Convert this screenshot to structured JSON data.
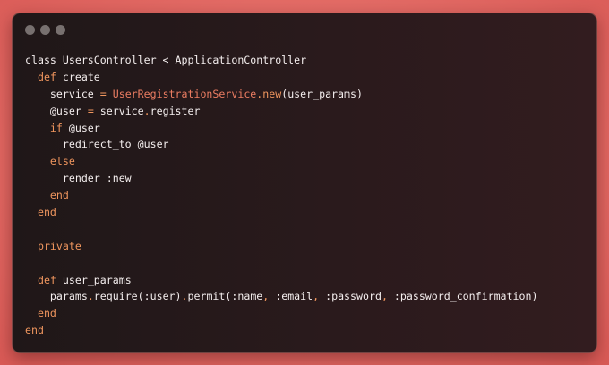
{
  "window": {
    "controls": [
      "close",
      "minimize",
      "maximize"
    ],
    "code_lines": [
      [
        {
          "t": "class UsersController < ApplicationController",
          "c": "pl"
        }
      ],
      [
        {
          "t": "  ",
          "c": "pl"
        },
        {
          "t": "def",
          "c": "kw"
        },
        {
          "t": " create",
          "c": "pl"
        }
      ],
      [
        {
          "t": "    service ",
          "c": "pl"
        },
        {
          "t": "=",
          "c": "op"
        },
        {
          "t": " ",
          "c": "pl"
        },
        {
          "t": "UserRegistrationService",
          "c": "cls"
        },
        {
          "t": ".",
          "c": "op"
        },
        {
          "t": "new",
          "c": "kw"
        },
        {
          "t": "(user_params)",
          "c": "pl"
        }
      ],
      [
        {
          "t": "    @user ",
          "c": "pl"
        },
        {
          "t": "=",
          "c": "op"
        },
        {
          "t": " service",
          "c": "pl"
        },
        {
          "t": ".",
          "c": "op"
        },
        {
          "t": "register",
          "c": "pl"
        }
      ],
      [
        {
          "t": "    ",
          "c": "pl"
        },
        {
          "t": "if",
          "c": "kw"
        },
        {
          "t": " @user",
          "c": "pl"
        }
      ],
      [
        {
          "t": "      redirect_to @user",
          "c": "pl"
        }
      ],
      [
        {
          "t": "    ",
          "c": "pl"
        },
        {
          "t": "else",
          "c": "kw"
        }
      ],
      [
        {
          "t": "      render :new",
          "c": "pl"
        }
      ],
      [
        {
          "t": "    ",
          "c": "pl"
        },
        {
          "t": "end",
          "c": "kw"
        }
      ],
      [
        {
          "t": "  ",
          "c": "pl"
        },
        {
          "t": "end",
          "c": "kw"
        }
      ],
      [
        {
          "t": "",
          "c": "pl"
        }
      ],
      [
        {
          "t": "  ",
          "c": "pl"
        },
        {
          "t": "private",
          "c": "kw"
        }
      ],
      [
        {
          "t": "",
          "c": "pl"
        }
      ],
      [
        {
          "t": "  ",
          "c": "pl"
        },
        {
          "t": "def",
          "c": "kw"
        },
        {
          "t": " user_params",
          "c": "pl"
        }
      ],
      [
        {
          "t": "    params",
          "c": "pl"
        },
        {
          "t": ".",
          "c": "op"
        },
        {
          "t": "require(:user)",
          "c": "pl"
        },
        {
          "t": ".",
          "c": "op"
        },
        {
          "t": "permit(:name",
          "c": "pl"
        },
        {
          "t": ",",
          "c": "op"
        },
        {
          "t": " :email",
          "c": "pl"
        },
        {
          "t": ",",
          "c": "op"
        },
        {
          "t": " :password",
          "c": "pl"
        },
        {
          "t": ",",
          "c": "op"
        },
        {
          "t": " :password_confirmation)",
          "c": "pl"
        }
      ],
      [
        {
          "t": "  ",
          "c": "pl"
        },
        {
          "t": "end",
          "c": "kw"
        }
      ],
      [
        {
          "t": "end",
          "c": "kw"
        }
      ]
    ]
  },
  "colors": {
    "background": "#e6706a",
    "window": "#2a1a1c",
    "keyword": "#f0965e",
    "class_name": "#ec7d62",
    "text": "#f4eeee",
    "window_dot": "#77706f"
  }
}
